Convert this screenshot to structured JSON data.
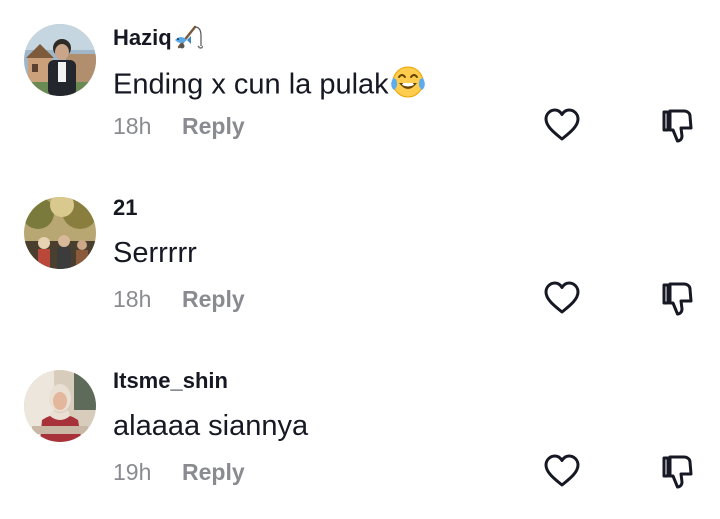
{
  "comments": [
    {
      "username": "Haziq",
      "username_emoji": "fishing-pole-icon",
      "text": "Ending x cun la pulak",
      "text_emoji": "face-with-tears-of-joy-icon",
      "time": "18h",
      "reply_label": "Reply"
    },
    {
      "username": "21",
      "text": "Serrrrr",
      "time": "18h",
      "reply_label": "Reply"
    },
    {
      "username": "Itsme_shin",
      "text": "alaaaa siannya",
      "time": "19h",
      "reply_label": "Reply"
    }
  ],
  "colors": {
    "primary_text": "#161823",
    "secondary_text": "#8a8b91",
    "icon_stroke": "#161823"
  }
}
